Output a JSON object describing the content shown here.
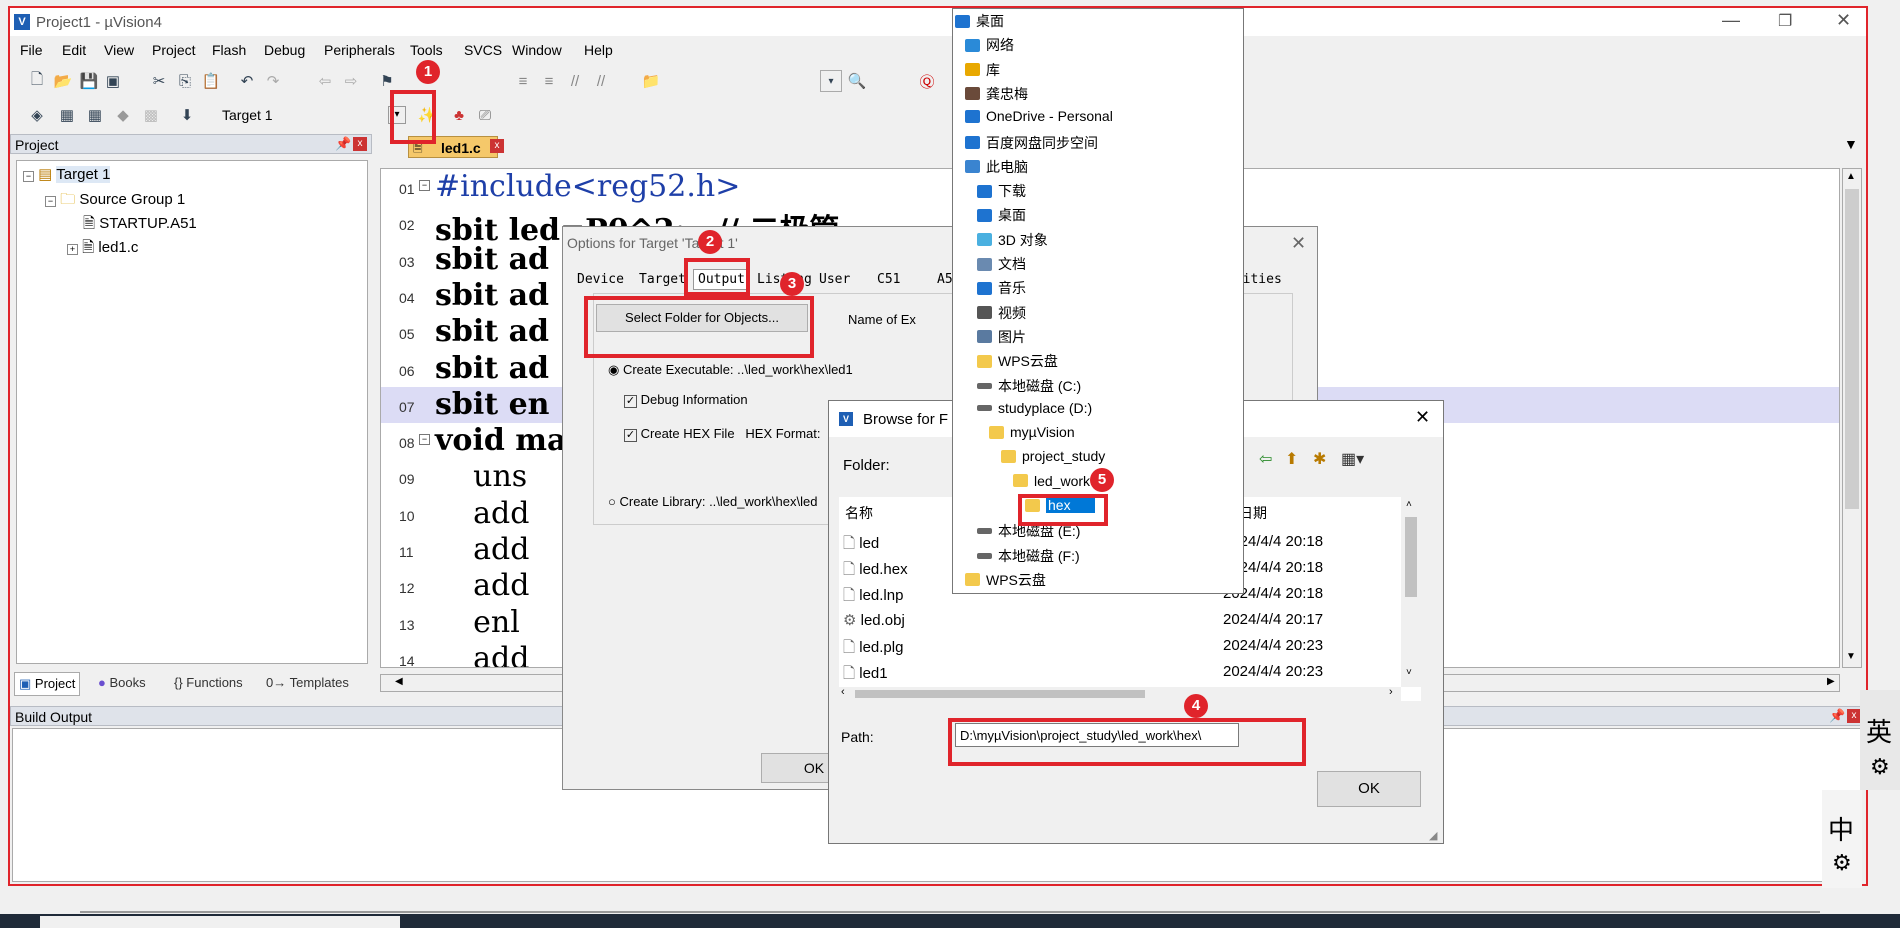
{
  "window": {
    "title": "Project1 - µVision4"
  },
  "menu": [
    "File",
    "Edit",
    "View",
    "Project",
    "Flash",
    "Debug",
    "Peripherals",
    "Tools",
    "SVCS",
    "Window",
    "Help"
  ],
  "toolbar": {
    "target": "Target 1"
  },
  "project_panel": {
    "title": "Project",
    "tree": [
      "Target 1",
      "Source Group 1",
      "STARTUP.A51",
      "led1.c"
    ],
    "tabs": [
      "Project",
      "Books",
      "{} Functions",
      "0→ Templates"
    ]
  },
  "editor": {
    "tab": "led1.c",
    "lines": [
      {
        "n": "01",
        "text": "#include<reg52.h>"
      },
      {
        "n": "02",
        "text": "sbit led=P0^2;   // 二极管"
      },
      {
        "n": "03",
        "text": "sbit ad"
      },
      {
        "n": "04",
        "text": "sbit ad"
      },
      {
        "n": "05",
        "text": "sbit ad"
      },
      {
        "n": "06",
        "text": "sbit ad"
      },
      {
        "n": "07",
        "text": "sbit en"
      },
      {
        "n": "08",
        "text": "void ma"
      },
      {
        "n": "09",
        "text": "    uns"
      },
      {
        "n": "10",
        "text": "    add"
      },
      {
        "n": "11",
        "text": "    add"
      },
      {
        "n": "12",
        "text": "    add"
      },
      {
        "n": "13",
        "text": "    enl"
      },
      {
        "n": "14",
        "text": "    add"
      }
    ]
  },
  "build_output": {
    "title": "Build Output"
  },
  "options_dialog": {
    "title": "Options for Target 'Target 1'",
    "tabs": [
      "Device",
      "Target",
      "Output",
      "Listing",
      "User",
      "C51",
      "A5",
      "ilities"
    ],
    "select_folder": "Select Folder for Objects...",
    "name_label": "Name of Ex",
    "create_exe": "Create Executable:  ..\\led_work\\hex\\led1",
    "debug_info": "Debug Information",
    "create_hex": "Create HEX File",
    "hex_format": "HEX Format:",
    "create_lib": "Create Library:  ..\\led_work\\hex\\led",
    "ok": "OK"
  },
  "browse_dialog": {
    "title": "Browse for F",
    "folder_label": "Folder:",
    "col_name": "名称",
    "col_date": "日期",
    "files": [
      {
        "name": "led",
        "date": "2024/4/4 20:18"
      },
      {
        "name": "led.hex",
        "date": "2024/4/4 20:18"
      },
      {
        "name": "led.lnp",
        "date": "2024/4/4 20:18"
      },
      {
        "name": "led.obj",
        "date": "2024/4/4 20:17"
      },
      {
        "name": "led.plg",
        "date": "2024/4/4 20:23"
      },
      {
        "name": "led1",
        "date": "2024/4/4 20:23"
      }
    ],
    "path_label": "Path:",
    "path": "D:\\myµVision\\project_study\\led_work\\hex\\",
    "ok": "OK"
  },
  "folder_tree": [
    "桌面",
    "网络",
    "库",
    "龚忠梅",
    "OneDrive - Personal",
    "百度网盘同步空间",
    "此电脑",
    "下载",
    "桌面",
    "3D 对象",
    "文档",
    "音乐",
    "视频",
    "图片",
    "WPS云盘",
    "本地磁盘 (C:)",
    "studyplace (D:)",
    "myµVision",
    "project_study",
    "led_work",
    "hex",
    "本地磁盘 (E:)",
    "本地磁盘 (F:)",
    "WPS云盘"
  ],
  "ime": {
    "top": "英",
    "bottom": "中"
  },
  "badges": [
    "1",
    "2",
    "3",
    "4",
    "5"
  ],
  "colors": {
    "highlight": "#e0242b",
    "selection": "#0078d7",
    "accent": "#1e5fb4"
  }
}
